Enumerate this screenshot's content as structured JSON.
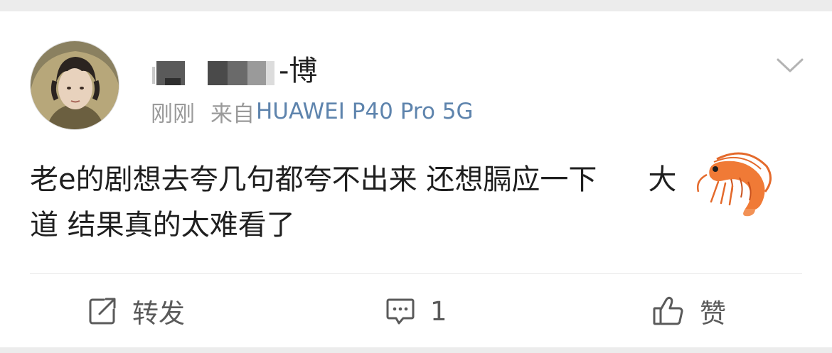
{
  "post": {
    "username_suffix": "-博",
    "timestamp": "刚刚",
    "source_prefix": "来自",
    "source_device": "HUAWEI P40 Pro 5G",
    "text_line1": "老e的剧想去夸几句都夸不出来 还想膈应一下",
    "text_line1_tail": "大",
    "text_line2": "道 结果真的太难看了"
  },
  "actions": {
    "repost_label": "转发",
    "comment_count": "1",
    "like_label": "赞"
  },
  "icons": {
    "avatar": "avatar-photo",
    "menu": "chevron-down-icon",
    "emoji": "shrimp-emoji",
    "repost": "share-edit-icon",
    "comment": "comment-bubble-icon",
    "like": "thumbs-up-icon"
  },
  "colors": {
    "background": "#ebebeb",
    "card": "#ffffff",
    "text": "#1f1f1f",
    "meta_gray": "#9a9a9a",
    "device_link": "#5e84ad",
    "action_gray": "#5a5a5a"
  }
}
